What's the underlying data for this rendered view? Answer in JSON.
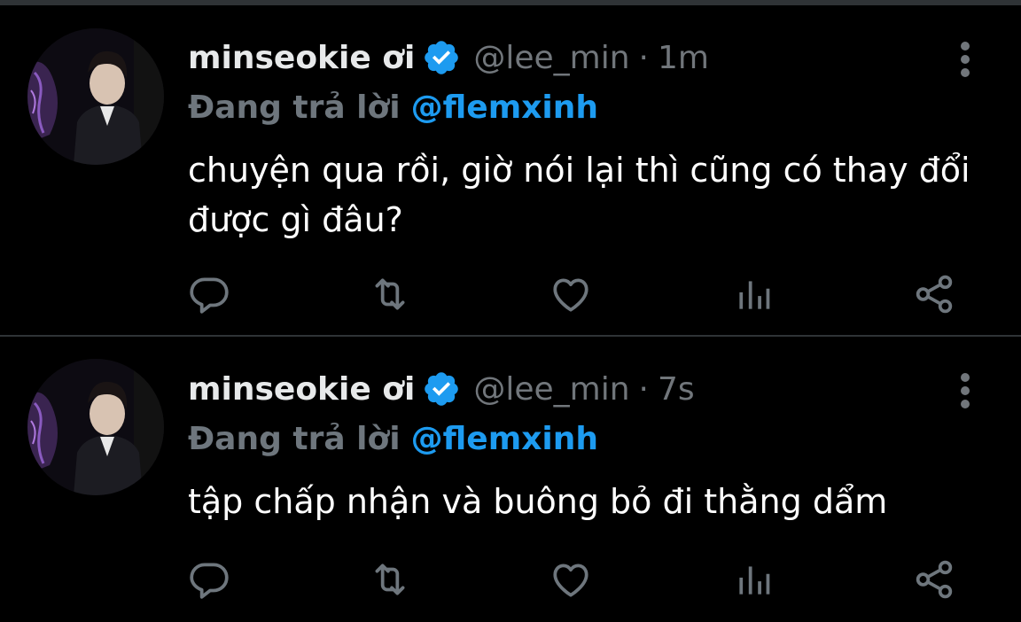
{
  "colors": {
    "background": "#000000",
    "divider": "#2f3336",
    "name": "#e7e9ea",
    "muted": "#71767b",
    "accent": "#1d9bf0",
    "icon": "#6e767d"
  },
  "tweets": [
    {
      "display_name": "minseokie ơi",
      "verified_icon": "verified-badge-icon",
      "handle": "@lee_min",
      "separator": "·",
      "time": "1m",
      "reply_prefix": "Đang trả lời",
      "reply_to": "@flemxinh",
      "text": "chuyện qua rồi, giờ nói lại thì cũng có thay đổi được gì đâu?"
    },
    {
      "display_name": "minseokie ơi",
      "verified_icon": "verified-badge-icon",
      "handle": "@lee_min",
      "separator": "·",
      "time": "7s",
      "reply_prefix": "Đang trả lời",
      "reply_to": "@flemxinh",
      "text": "tập chấp nhận và buông bỏ đi thằng dẩm"
    }
  ],
  "action_icons": [
    "reply-icon",
    "retweet-icon",
    "like-icon",
    "stats-icon",
    "share-icon"
  ]
}
